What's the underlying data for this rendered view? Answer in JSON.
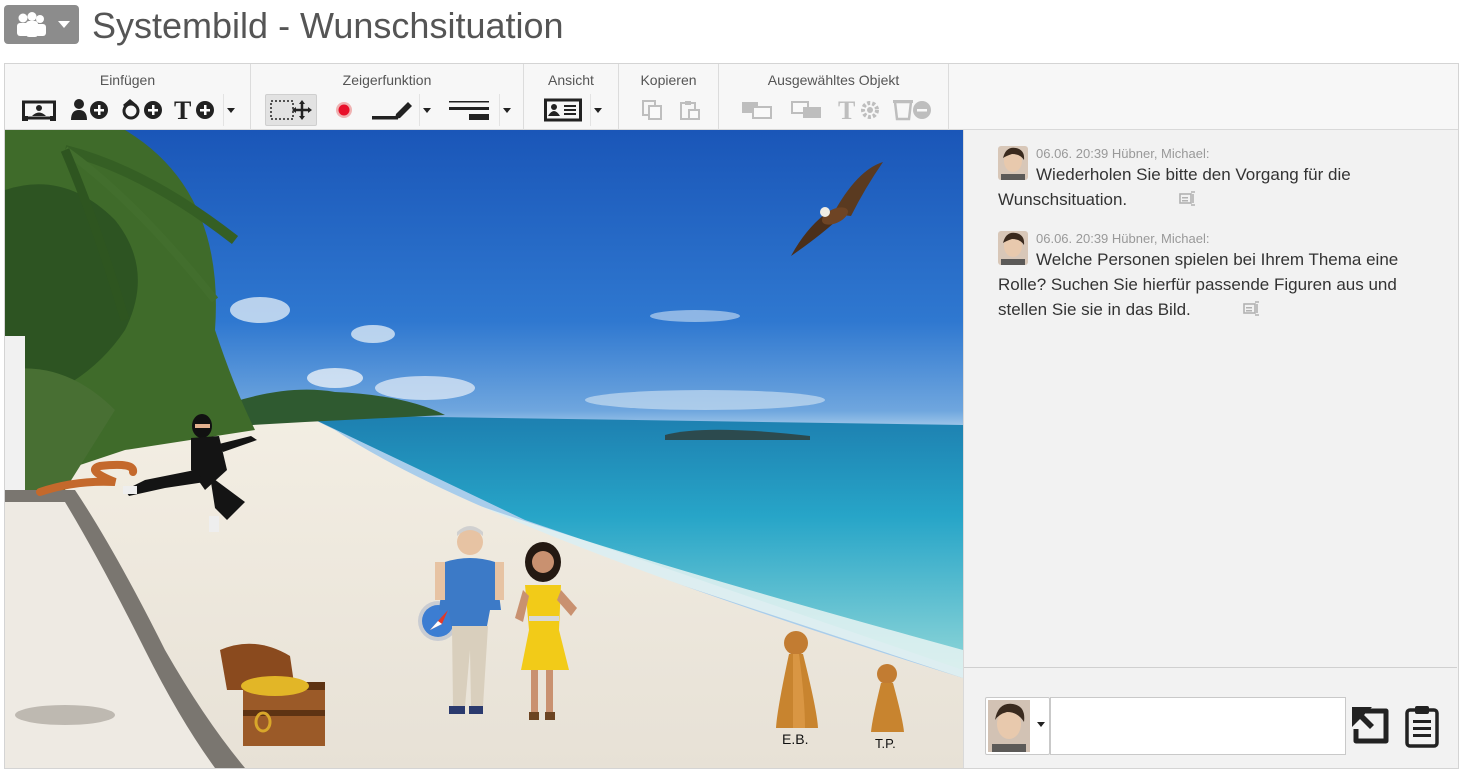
{
  "header": {
    "title": "Systembild - Wunschsituation",
    "app_menu_icon": "group-people-icon"
  },
  "ribbon": {
    "groups": [
      {
        "label": "Einfügen",
        "tools": [
          "insert-background-icon",
          "add-person-icon",
          "add-object-icon",
          "add-text-icon"
        ]
      },
      {
        "label": "Zeigerfunktion",
        "tools": [
          "select-move-icon",
          "pointer-dot-icon",
          "pen-icon",
          "line-style-icon"
        ]
      },
      {
        "label": "Ansicht",
        "tools": [
          "view-layout-icon"
        ]
      },
      {
        "label": "Kopieren",
        "tools": [
          "copy-icon",
          "paste-icon"
        ]
      },
      {
        "label": "Ausgewähltes Objekt",
        "tools": [
          "bring-front-icon",
          "send-back-icon",
          "text-settings-icon",
          "delete-object-icon"
        ]
      }
    ]
  },
  "canvas": {
    "labels": {
      "eb": "E.B.",
      "tp": "T.P."
    },
    "colors": {
      "sky": "#2f78d0",
      "sea": "#2aa6c8",
      "sand": "#efe9df"
    }
  },
  "chat": {
    "messages": [
      {
        "meta": "06.06. 20:39 Hübner, Michael:",
        "text": "Wiederholen Sie bitte den Vorgang für die Wunschsituation."
      },
      {
        "meta": "06.06. 20:39 Hübner, Michael:",
        "text": "Welche Personen spielen bei Ihrem Thema eine Rolle? Suchen Sie hierfür passende Figuren aus und stellen Sie sie in das Bild."
      }
    ],
    "input": {
      "value": "",
      "placeholder": ""
    }
  }
}
